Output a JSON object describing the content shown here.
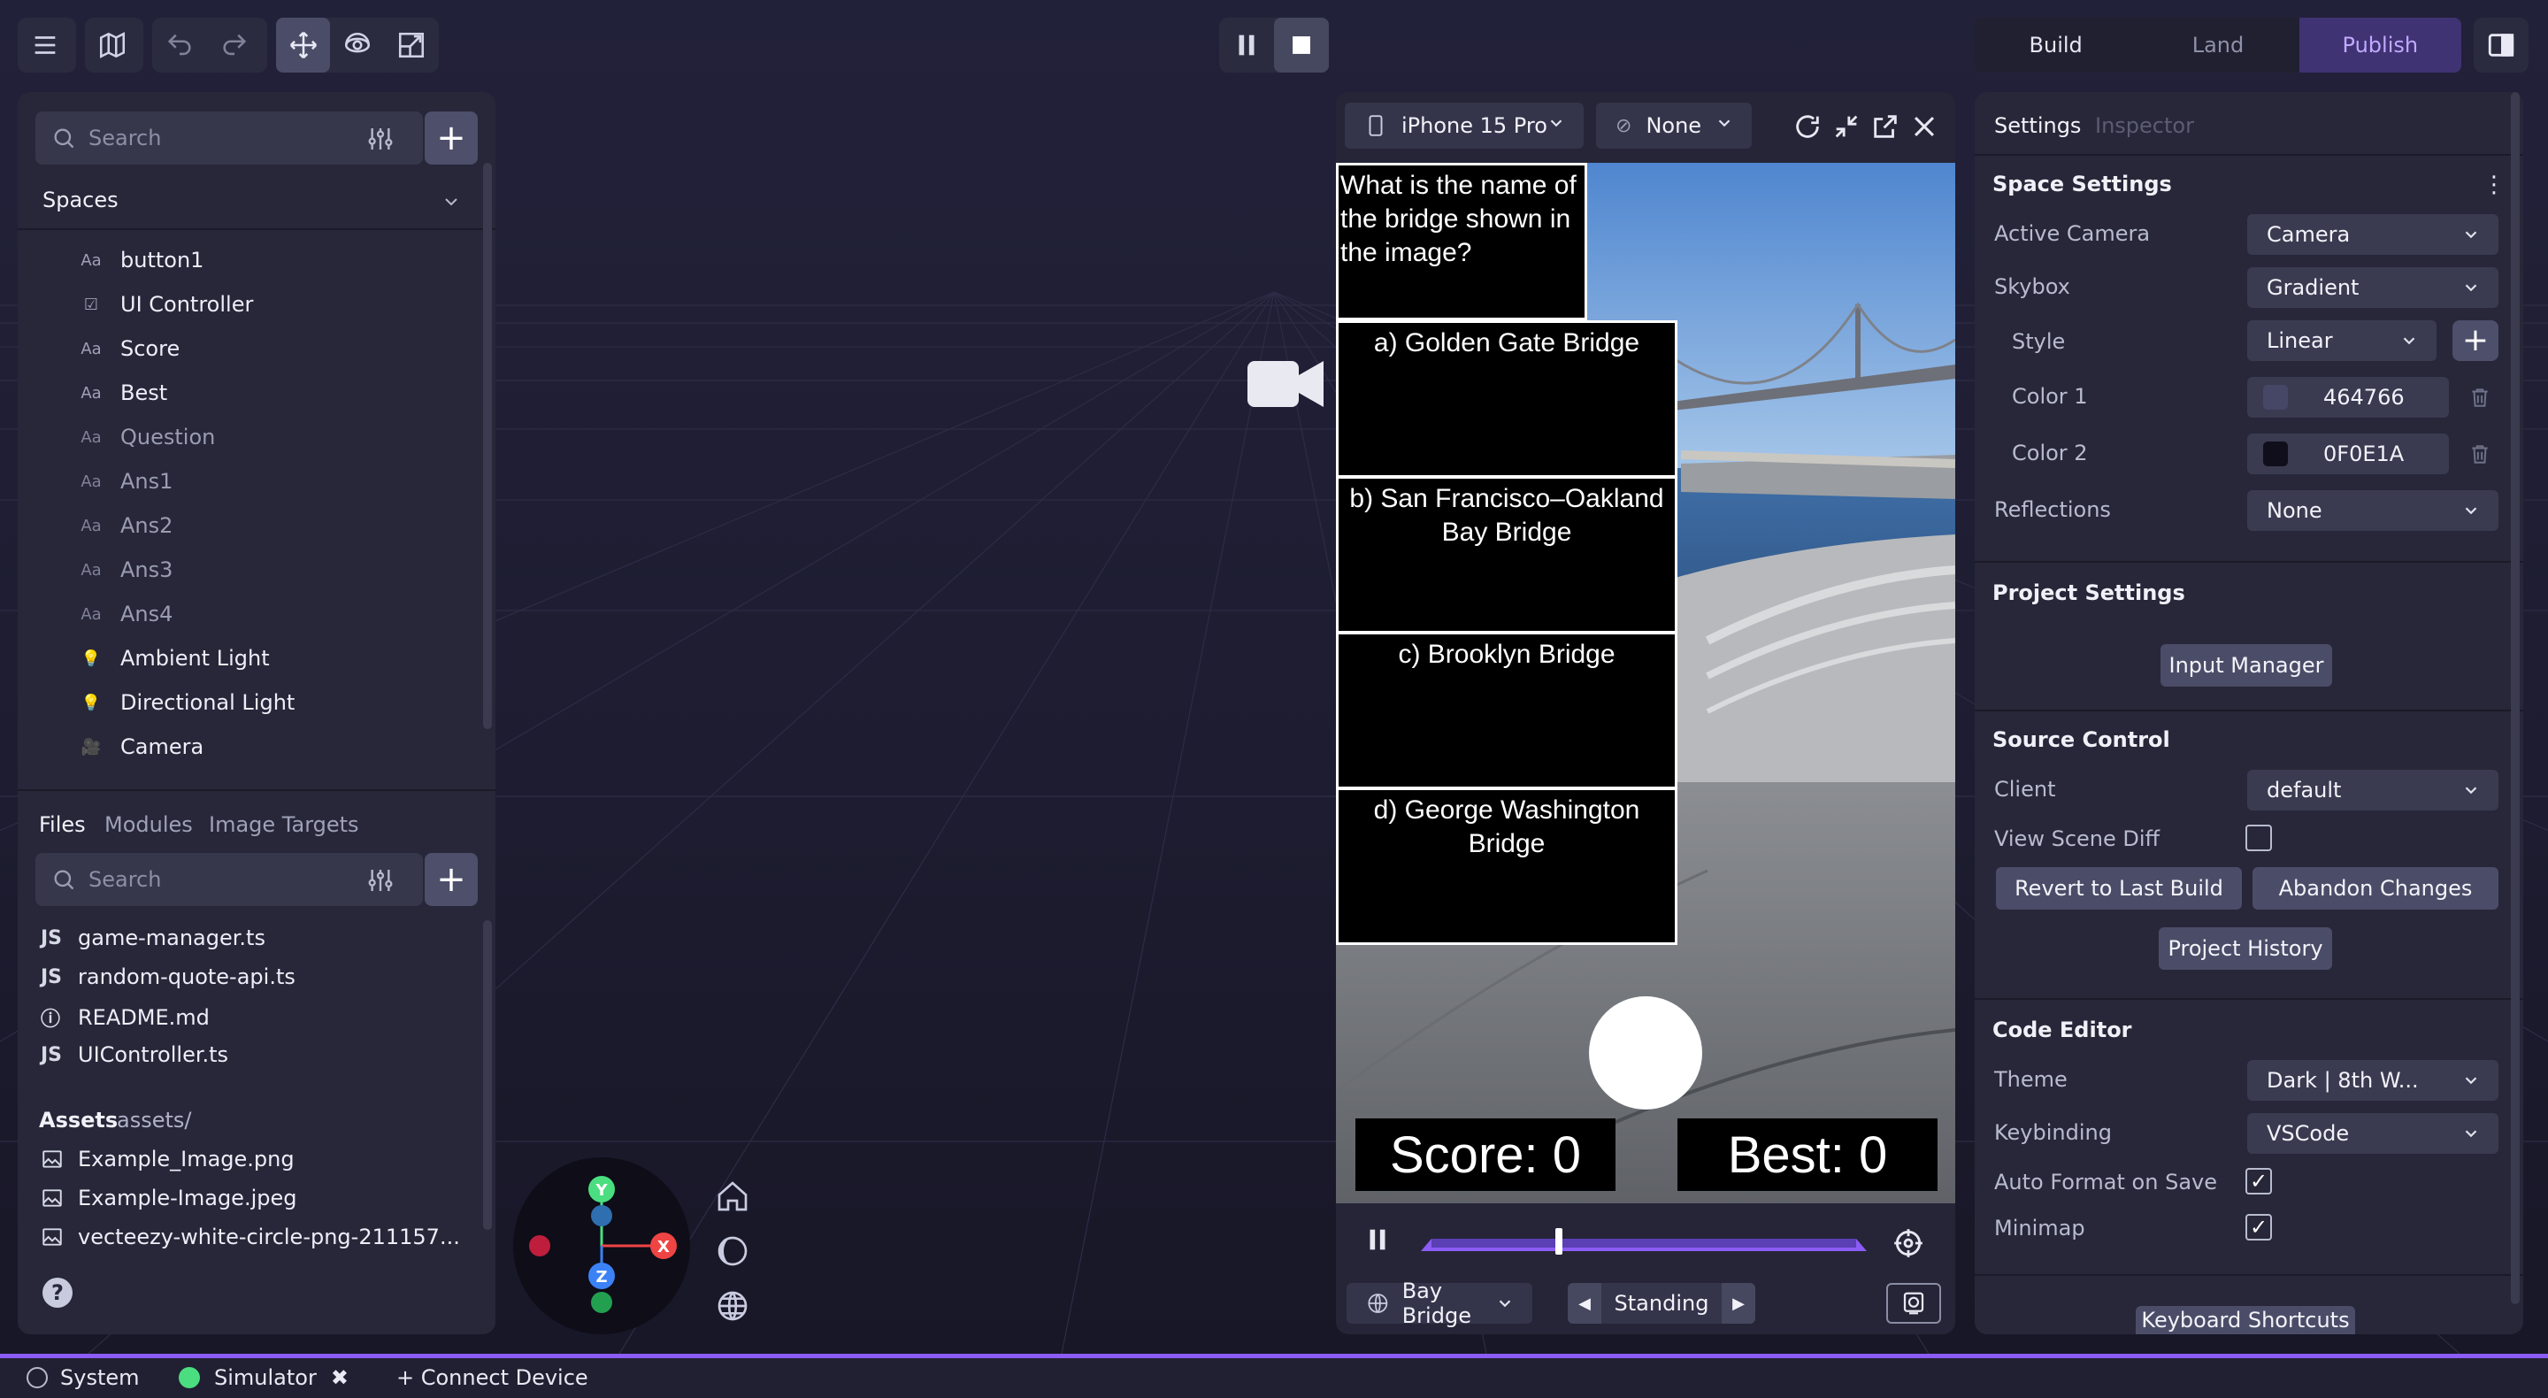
{
  "toolbar": {
    "menu_icon": "hamburger-icon",
    "map_icon": "map-icon",
    "undo_icon": "undo-icon",
    "redo_icon": "redo-icon",
    "move_icon": "move-icon",
    "rotate_icon": "rotate-icon",
    "scale_icon": "scale-icon",
    "pause_icon": "pause-icon",
    "stop_icon": "stop-icon"
  },
  "mode_tabs": [
    "Build",
    "Land",
    "Publish"
  ],
  "active_mode": "Publish",
  "hierarchy": {
    "search_placeholder": "Search",
    "section_label": "Spaces",
    "items": [
      {
        "icon": "Aa",
        "label": "button1",
        "dim": false
      },
      {
        "icon": "☑",
        "label": "UI Controller",
        "dim": false
      },
      {
        "icon": "Aa",
        "label": "Score",
        "dim": false
      },
      {
        "icon": "Aa",
        "label": "Best",
        "dim": false
      },
      {
        "icon": "Aa",
        "label": "Question",
        "dim": true
      },
      {
        "icon": "Aa",
        "label": "Ans1",
        "dim": true
      },
      {
        "icon": "Aa",
        "label": "Ans2",
        "dim": true
      },
      {
        "icon": "Aa",
        "label": "Ans3",
        "dim": true
      },
      {
        "icon": "Aa",
        "label": "Ans4",
        "dim": true
      },
      {
        "icon": "💡",
        "label": "Ambient Light",
        "dim": false
      },
      {
        "icon": "💡",
        "label": "Directional Light",
        "dim": false
      },
      {
        "icon": "🎥",
        "label": "Camera",
        "dim": false
      }
    ]
  },
  "files_panel": {
    "tabs": [
      "Files",
      "Modules",
      "Image Targets"
    ],
    "search_placeholder": "Search",
    "files": [
      {
        "icon": "JS",
        "name": "game-manager.ts"
      },
      {
        "icon": "JS",
        "name": "random-quote-api.ts"
      },
      {
        "icon": "ⓘ",
        "name": "README.md"
      },
      {
        "icon": "JS",
        "name": "UIController.ts"
      }
    ],
    "assets_label": "Assets",
    "assets_path": "assets/",
    "assets": [
      {
        "name": "Example_Image.png"
      },
      {
        "name": "Example-Image.jpeg"
      },
      {
        "name": "vecteezy-white-circle-png-211157..."
      }
    ]
  },
  "simulator": {
    "device": "iPhone 15 Pro",
    "overlay": "None",
    "question": "What is the name of the bridge shown in the image?",
    "answers": [
      "a) Golden Gate Bridge",
      "b) San Francisco–Oakland Bay Bridge",
      "c) Brooklyn Bridge",
      "d) George Washington Bridge"
    ],
    "score_text": "Score: 0",
    "best_text": "Best: 0",
    "location": "Bay Bridge",
    "pose": "Standing",
    "timeline_position": 0.3
  },
  "inspector": {
    "tabs": [
      "Settings",
      "Inspector"
    ],
    "space_settings": {
      "title": "Space Settings",
      "active_camera_label": "Active Camera",
      "active_camera": "Camera",
      "skybox_label": "Skybox",
      "skybox": "Gradient",
      "style_label": "Style",
      "style": "Linear",
      "color1_label": "Color 1",
      "color1": "464766",
      "color1_hex": "#464766",
      "color2_label": "Color 2",
      "color2": "0F0E1A",
      "color2_hex": "#0F0E1A",
      "reflections_label": "Reflections",
      "reflections": "None"
    },
    "project_settings": {
      "title": "Project Settings",
      "input_manager": "Input Manager"
    },
    "source_control": {
      "title": "Source Control",
      "client_label": "Client",
      "client": "default",
      "view_scene_diff_label": "View Scene Diff",
      "revert": "Revert to Last Build",
      "abandon": "Abandon Changes",
      "history": "Project History"
    },
    "code_editor": {
      "title": "Code Editor",
      "theme_label": "Theme",
      "theme": "Dark | 8th W...",
      "keybinding_label": "Keybinding",
      "keybinding": "VSCode",
      "auto_format_label": "Auto Format on Save",
      "minimap_label": "Minimap",
      "keyboard_shortcuts": "Keyboard Shortcuts"
    }
  },
  "status_bar": {
    "system": "System",
    "simulator": "Simulator",
    "connect": "+ Connect Device"
  },
  "colors": {
    "accent": "#8b5cf6",
    "publish_tab": "#4a3b8a",
    "status_green": "#4ade80"
  }
}
